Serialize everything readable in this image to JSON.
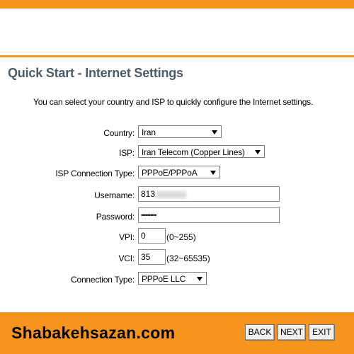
{
  "page": {
    "title": "Quick Start - Internet Settings",
    "description": "You can select your country and ISP to quickly configure the Internet settings."
  },
  "form": {
    "country": {
      "label": "Country:",
      "value": "Iran"
    },
    "isp": {
      "label": "ISP:",
      "value": "Iran Telecom (Copper Lines)"
    },
    "isp_connection_type": {
      "label": "ISP Connection Type:",
      "value": "PPPoE/PPPoA"
    },
    "username": {
      "label": "Username:",
      "value": "813"
    },
    "password": {
      "label": "Password:",
      "value": "••••••••••"
    },
    "vpi": {
      "label": "VPI:",
      "value": "0",
      "range": "(0~255)"
    },
    "vci": {
      "label": "VCI:",
      "value": "35",
      "range": "(32~65535)"
    },
    "connection_type": {
      "label": "Connection Type:",
      "value": "PPPoE LLC"
    }
  },
  "footer": {
    "brand": "Shabakehsazan.com",
    "back_label": "BACK",
    "next_label": "NEXT",
    "exit_label": "EXIT"
  },
  "colors": {
    "accent": "#f7941d",
    "title": "#4a5c6a"
  }
}
